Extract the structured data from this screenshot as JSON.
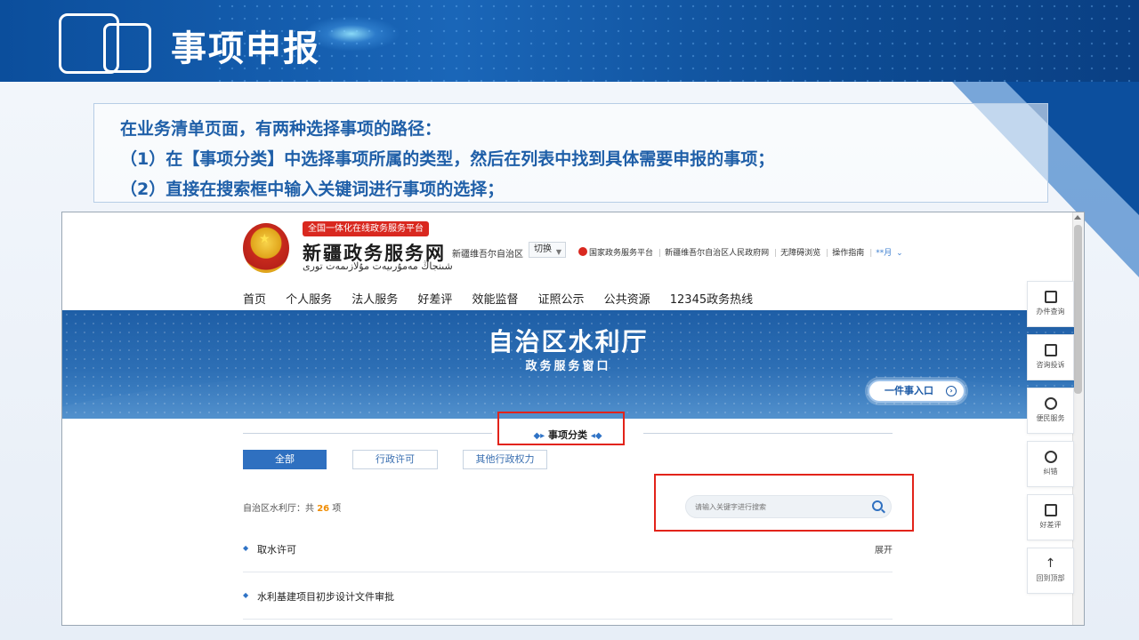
{
  "slide": {
    "title": "事项申报",
    "intro": [
      "在业务清单页面，有两种选择事项的路径：",
      "（1）在【事项分类】中选择事项所属的类型，然后在列表中找到具体需要申报的事项；",
      "（2）直接在搜索框中输入关键词进行事项的选择；"
    ]
  },
  "site": {
    "badge": "全国一体化在线政务服务平台",
    "name": "新疆政务服务网",
    "name_uyghur": "شىنجاڭ مەمۇرىيەت مۇلازىمەت تورى",
    "region": "新疆维吾尔自治区",
    "switch_label": "切换",
    "top_links": [
      "国家政务服务平台",
      "新疆维吾尔自治区人民政府网",
      "无障碍浏览",
      "操作指南"
    ],
    "user": "**月"
  },
  "nav": [
    "首页",
    "个人服务",
    "法人服务",
    "好差评",
    "效能监督",
    "证照公示",
    "公共资源",
    "12345政务热线"
  ],
  "banner": {
    "title": "自治区水利厅",
    "subtitle": "政务服务窗口",
    "one_entry": "一件事入口"
  },
  "category": {
    "title": "事项分类",
    "filters": [
      "全部",
      "行政许可",
      "其他行政权力"
    ]
  },
  "list": {
    "count_prefix": "自治区水利厅：共",
    "count": "26",
    "count_suffix": "项",
    "search_placeholder": "请输入关键字进行搜索",
    "rows": [
      {
        "label": "取水许可",
        "action": "展开"
      },
      {
        "label": "水利基建项目初步设计文件审批",
        "action": ""
      }
    ]
  },
  "side_tools": [
    "办件查询",
    "咨询投诉",
    "便民服务",
    "纠错",
    "好差评",
    "回到顶部"
  ],
  "colors": {
    "header_blue": "#0b4e9c",
    "accent_blue": "#2f70c0",
    "highlight_red": "#e2231a",
    "count_orange": "#f08c00"
  }
}
